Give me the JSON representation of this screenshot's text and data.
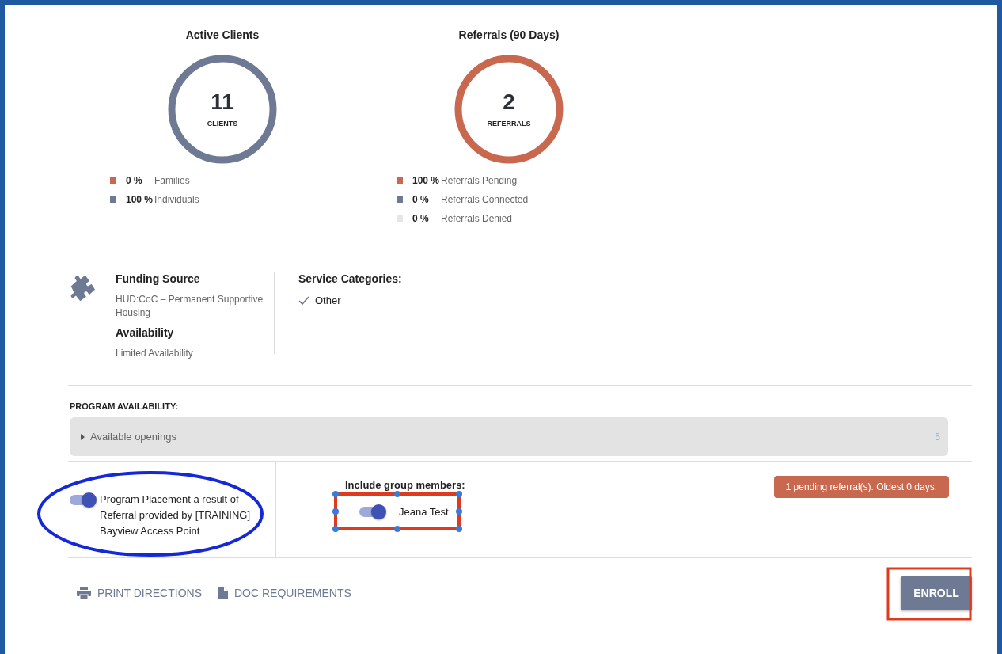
{
  "stats": [
    {
      "title": "Active Clients",
      "value": "11",
      "unit": "CLIENTS",
      "legend": [
        {
          "percent": "0 %",
          "label": "Families",
          "color": "#c8694f"
        },
        {
          "percent": "100 %",
          "label": "Individuals",
          "color": "#6e7a94"
        }
      ]
    },
    {
      "title": "Referrals (90 Days)",
      "value": "2",
      "unit": "REFERRALS",
      "legend": [
        {
          "percent": "100 %",
          "label": "Referrals Pending",
          "color": "#c8694f"
        },
        {
          "percent": "0 %",
          "label": "Referrals Connected",
          "color": "#6e7a94"
        },
        {
          "percent": "0 %",
          "label": "Referrals Denied",
          "color": "#e6e6e6"
        }
      ]
    }
  ],
  "funding": {
    "heading": "Funding Source",
    "value": "HUD:CoC – Permanent Supportive Housing"
  },
  "availability": {
    "heading": "Availability",
    "value": "Limited Availability"
  },
  "service_categories": {
    "heading": "Service Categories:",
    "items": [
      {
        "label": "Other",
        "checked": true
      }
    ]
  },
  "program_availability": {
    "heading": "PROGRAM AVAILABILITY:",
    "row": {
      "label": "Available openings",
      "count": "5",
      "expanded": false
    }
  },
  "referral_toggle": {
    "label": "Program Placement a result of Referral provided by [TRAINING] Bayview Access Point",
    "on": true
  },
  "group_members": {
    "heading": "Include group members:",
    "members": [
      {
        "name": "Jeana Test",
        "on": true
      }
    ]
  },
  "alert": "1 pending referral(s). Oldest 0 days.",
  "actions": [
    {
      "kind": "print",
      "label": "PRINT DIRECTIONS"
    },
    {
      "kind": "doc",
      "label": "DOC REQUIREMENTS"
    }
  ],
  "primary_button": "ENROLL"
}
